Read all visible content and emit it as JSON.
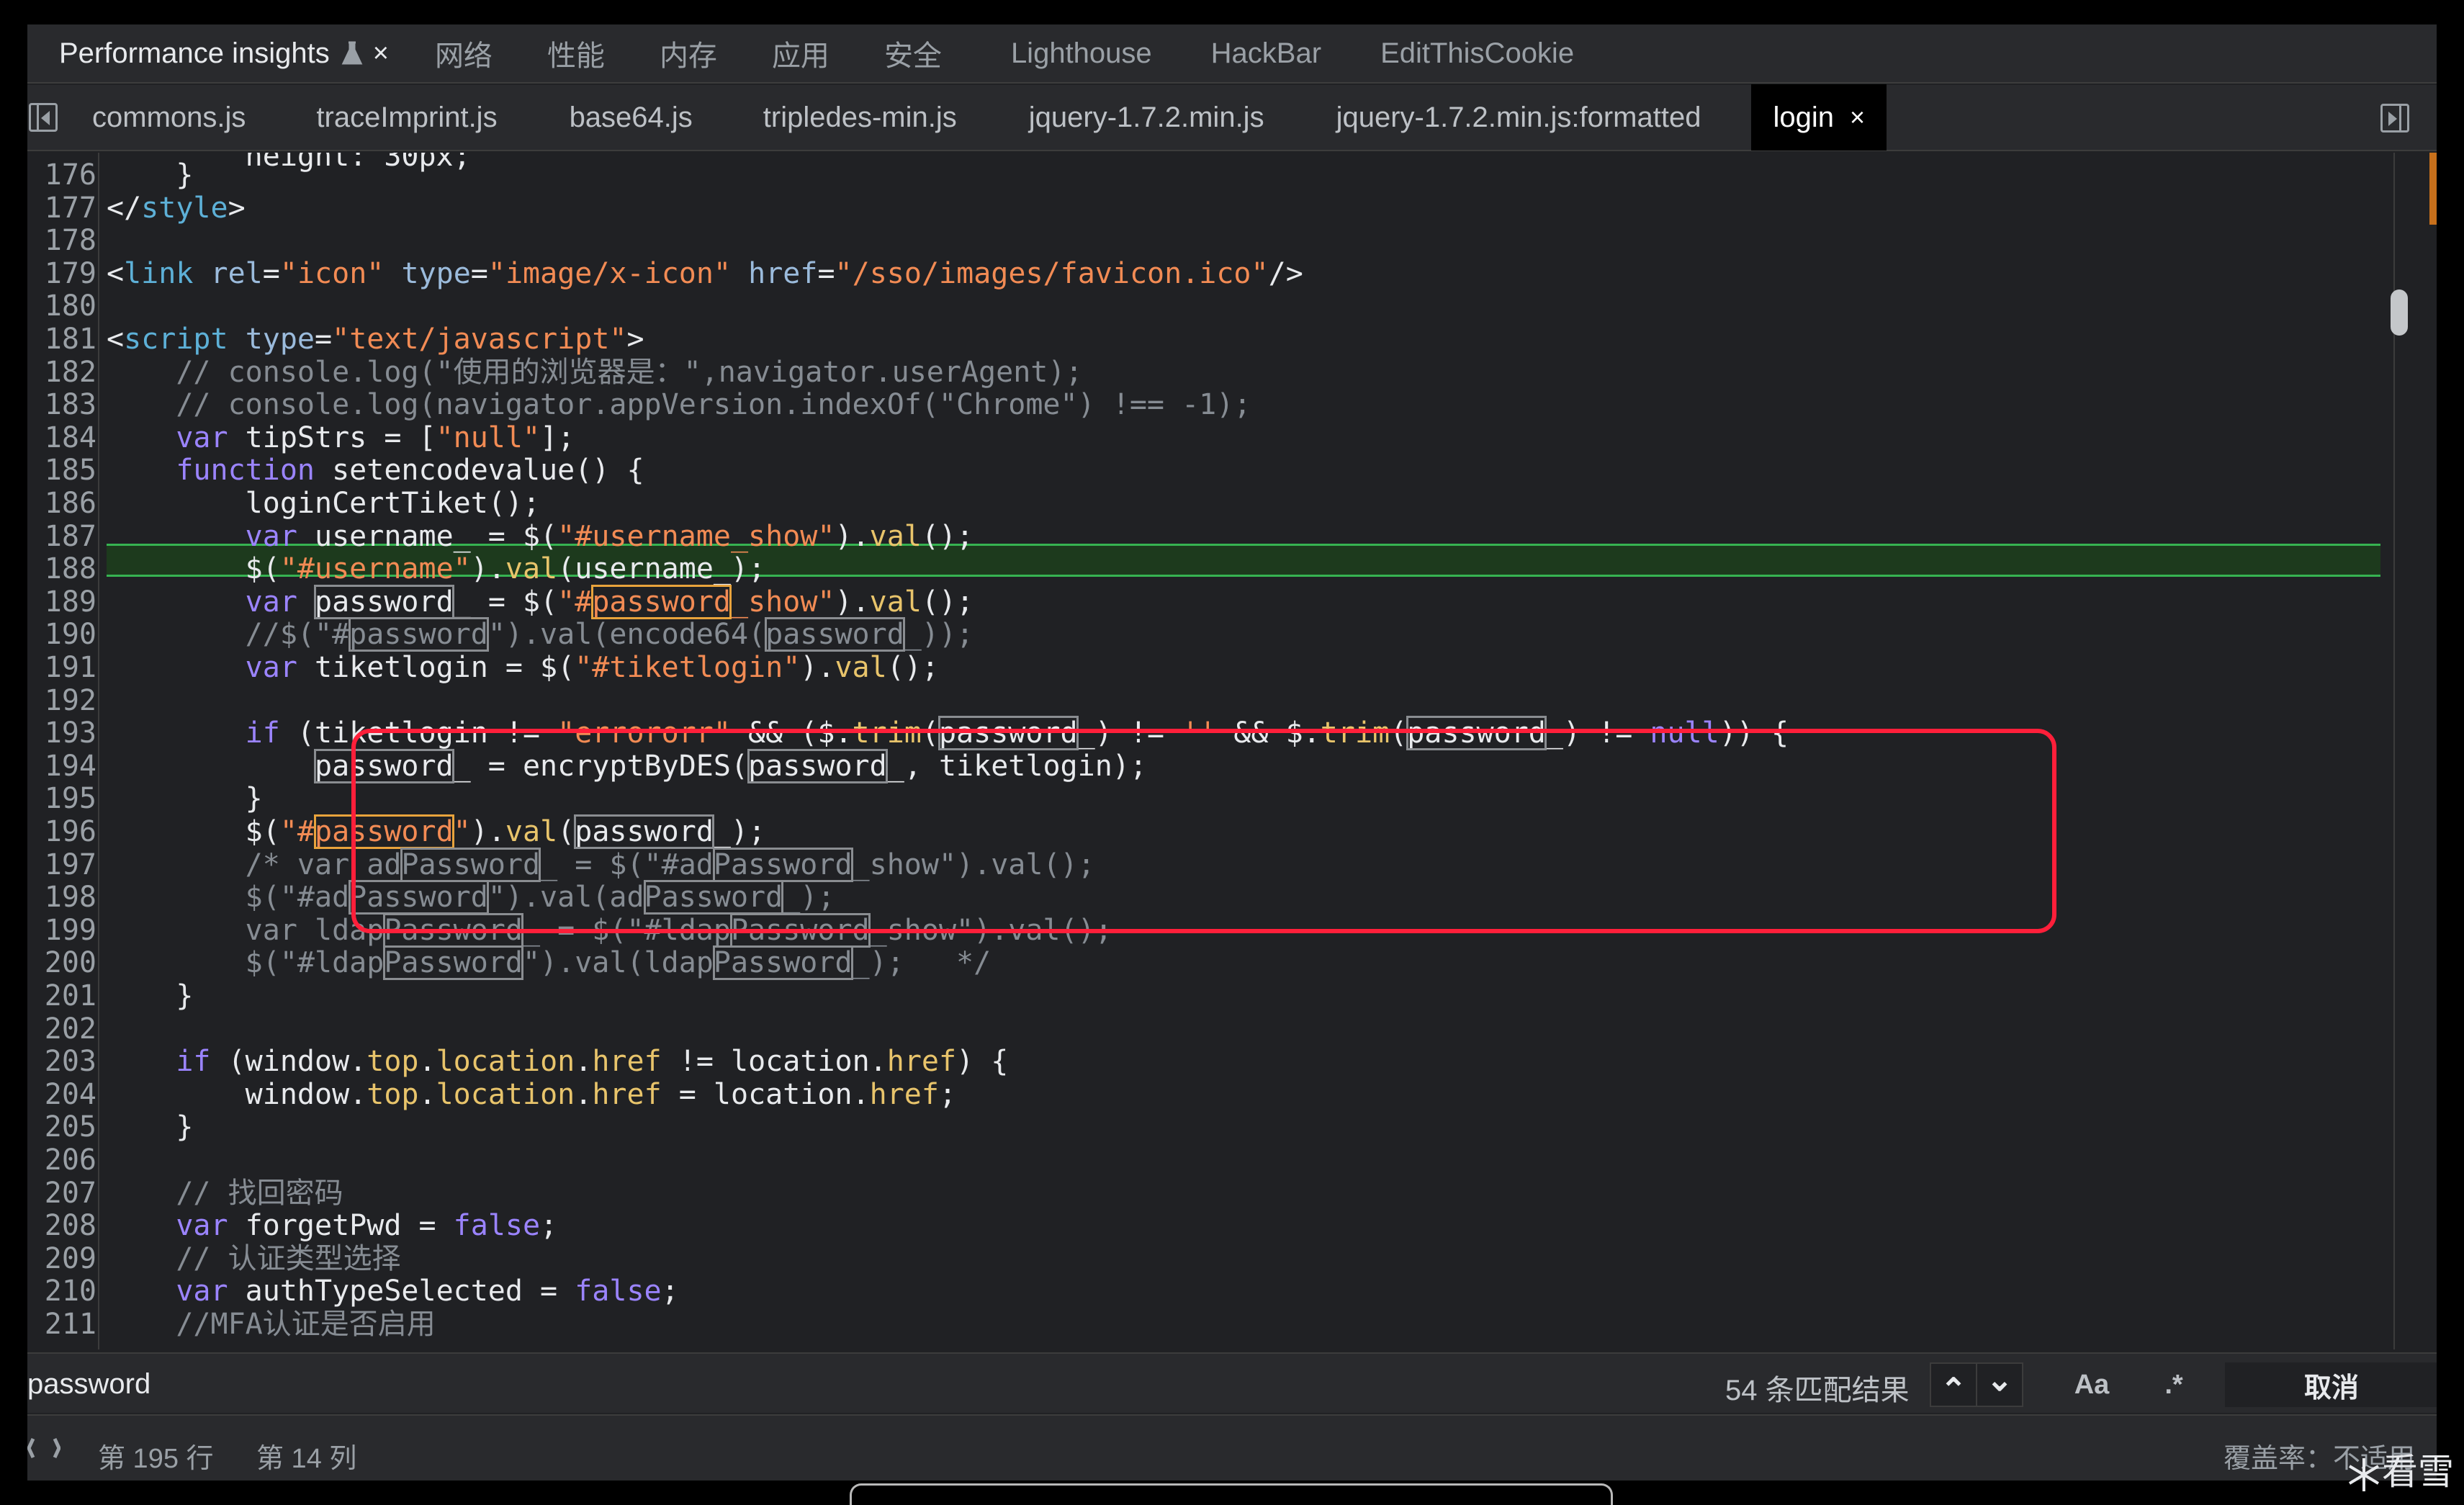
{
  "panel_tabs": [
    {
      "label": "Performance insights",
      "active": true
    },
    {
      "label": "网络"
    },
    {
      "label": "性能"
    },
    {
      "label": "内存"
    },
    {
      "label": "应用"
    },
    {
      "label": "安全"
    },
    {
      "label": "Lighthouse"
    },
    {
      "label": "HackBar"
    },
    {
      "label": "EditThisCookie"
    }
  ],
  "file_tabs": [
    {
      "label": "commons.js"
    },
    {
      "label": "traceImprint.js"
    },
    {
      "label": "base64.js"
    },
    {
      "label": "tripledes-min.js"
    },
    {
      "label": "jquery-1.7.2.min.js"
    },
    {
      "label": "jquery-1.7.2.min.js:formatted"
    },
    {
      "label": "login",
      "active": true
    }
  ],
  "close_glyph": "×",
  "line_numbers": [
    "176",
    "177",
    "178",
    "179",
    "180",
    "181",
    "182",
    "183",
    "184",
    "185",
    "186",
    "187",
    "188",
    "189",
    "190",
    "191",
    "192",
    "193",
    "194",
    "195",
    "196",
    "197",
    "198",
    "199",
    "200",
    "201",
    "202",
    "203",
    "204",
    "205",
    "206",
    "207",
    "208",
    "209",
    "210",
    "211"
  ],
  "partial_top_line": "height: 30px;",
  "code_lines": [
    "    }",
    "</style>",
    "",
    "<link rel=\"icon\" type=\"image/x-icon\" href=\"/sso/images/favicon.ico\"/>",
    "",
    "<script type=\"text/javascript\">",
    "    // console.log(\"使用的浏览器是：\",navigator.userAgent);",
    "    // console.log(navigator.appVersion.indexOf(\"Chrome\") !== -1);",
    "    var tipStrs = [\"null\"];",
    "    function setencodevalue() {",
    "        loginCertTiket();",
    "        var username_ = $(\"#username_show\").val();",
    "        $(\"#username\").val(username_);",
    "        var password_ = $(\"#password_show\").val();",
    "        //$(\"#password\").val(encode64(password_));",
    "        var tiketlogin = $(\"#tiketlogin\").val();",
    "",
    "        if (tiketlogin != \"errororr\" && ($.trim(password_) != '' && $.trim(password_) != null)) {",
    "            password_ = encryptByDES(password_, tiketlogin);",
    "        }",
    "        $(\"#password\").val(password_);",
    "        /* var adPassword_ = $(\"#adPassword_show\").val();",
    "        $(\"#adPassword\").val(adPassword_);",
    "        var ldapPassword_ = $(\"#ldapPassword_show\").val();",
    "        $(\"#ldapPassword\").val(ldapPassword_);   */",
    "    }",
    "",
    "    if (window.top.location.href != location.href) {",
    "        window.top.location.href = location.href;",
    "    }",
    "",
    "    // 找回密码",
    "    var forgetPwd = false;",
    "    // 认证类型选择",
    "    var authTypeSelected = false;",
    "    //MFA认证是否启用"
  ],
  "search": {
    "value": "password",
    "match_count": "54 条匹配结果",
    "prev_glyph": "⌃",
    "next_glyph": "⌄",
    "case_label": "Aa",
    "regex_label": ".*",
    "cancel_label": "取消"
  },
  "status": {
    "line": "第 195 行",
    "column": "第 14 列",
    "coverage": "覆盖率：不适用"
  },
  "watermark": "看雪",
  "colors": {
    "keyword": "#9b84ff",
    "string": "#f28b54",
    "comment": "#868c93",
    "highlight_line": "#36b351",
    "annotation_box": "#ff1f3a"
  }
}
